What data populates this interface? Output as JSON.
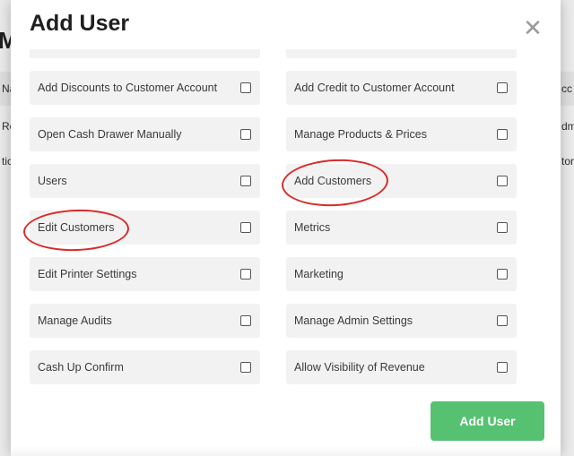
{
  "background": {
    "title": "M",
    "col1_header": "Na",
    "col2_header": "cc",
    "row1_left": "Ro",
    "row1_right": "dm",
    "row2_left": "tic",
    "row2_right": "tor"
  },
  "modal": {
    "title": "Add User",
    "close_glyph": "✕",
    "submit_label": "Add User",
    "colors": {
      "submit": "#56c271",
      "annotation": "#d92a2a",
      "field_bg": "#f2f2f2"
    },
    "left_permissions": [
      "Add Discounts to Customer Account",
      "Open Cash Drawer Manually",
      "Users",
      "Edit Customers",
      "Edit Printer Settings",
      "Manage Audits",
      "Cash Up Confirm"
    ],
    "right_permissions": [
      "Add Credit to Customer Account",
      "Manage Products & Prices",
      "Add Customers",
      "Metrics",
      "Marketing",
      "Manage Admin Settings",
      "Allow Visibility of Revenue"
    ]
  }
}
